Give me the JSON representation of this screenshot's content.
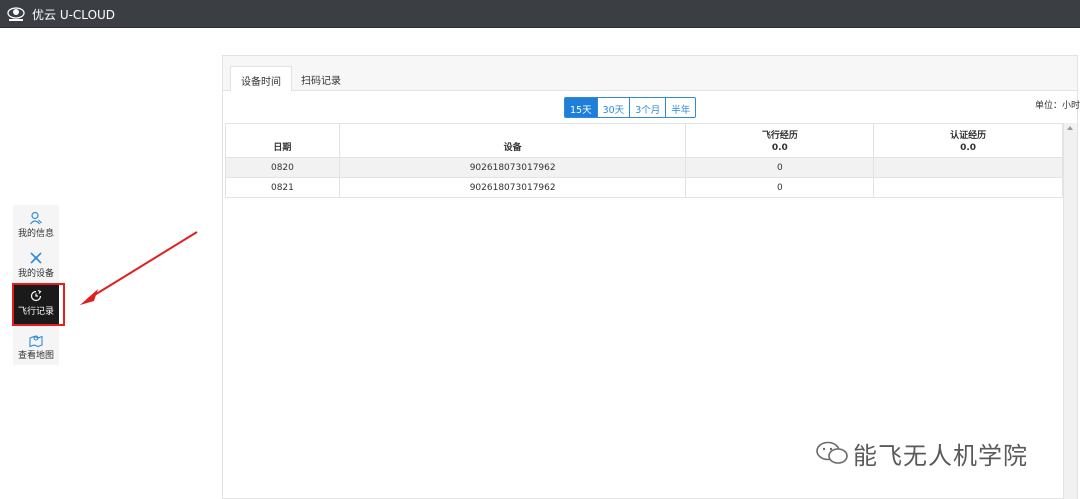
{
  "app": {
    "title": "优云 U-CLOUD"
  },
  "sidebar": {
    "items": [
      {
        "label": "我的信息",
        "icon": "user-icon"
      },
      {
        "label": "我的设备",
        "icon": "drone-icon"
      },
      {
        "label": "飞行记录",
        "icon": "history-icon",
        "active": true
      },
      {
        "label": "查看地图",
        "icon": "map-icon"
      }
    ]
  },
  "tabs": [
    {
      "label": "设备时间",
      "active": true
    },
    {
      "label": "扫码记录",
      "active": false
    }
  ],
  "range": {
    "options": [
      "15天",
      "30天",
      "3个月",
      "半年"
    ],
    "selected": "15天"
  },
  "unit_label": "单位：小时",
  "table": {
    "headers": {
      "date": "日期",
      "device": "设备",
      "flight": "飞行经历",
      "flight_total": "0.0",
      "cert": "认证经历",
      "cert_total": "0.0"
    },
    "rows": [
      {
        "date": "0820",
        "device": "902618073017962",
        "flight": "0",
        "cert": ""
      },
      {
        "date": "0821",
        "device": "902618073017962",
        "flight": "0",
        "cert": ""
      }
    ]
  },
  "watermark": {
    "text": "能飞无人机学院"
  },
  "colors": {
    "topbar": "#3b3f44",
    "accent": "#1e7fd9",
    "highlight": "#e02020"
  }
}
